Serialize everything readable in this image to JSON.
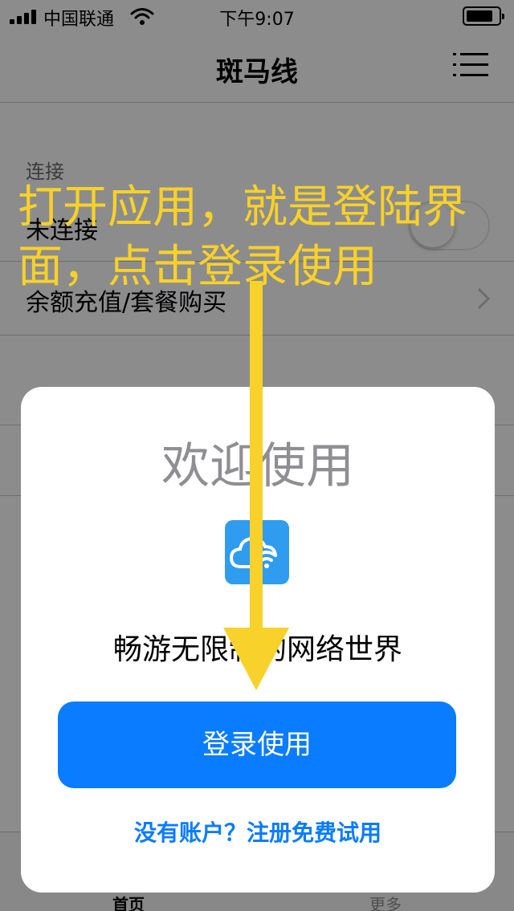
{
  "status_bar": {
    "carrier": "中国联通",
    "time": "下午9:07",
    "icons": [
      "signal-icon",
      "wifi-icon",
      "battery-icon"
    ]
  },
  "nav": {
    "title": "斑马线",
    "menu_icon": "menu-icon"
  },
  "background_list": {
    "section_header": "连接",
    "rows": [
      {
        "label": "未连接",
        "control": "switch",
        "switch_on": false
      },
      {
        "label": "余额充值/套餐购买",
        "control": "chevron"
      }
    ]
  },
  "tab_bar": {
    "tabs": [
      {
        "label": "首页",
        "active": true
      },
      {
        "label": "更多",
        "active": false
      }
    ]
  },
  "modal": {
    "title": "欢迎使用",
    "icon": "cloud-wifi-app-icon",
    "slogan": "畅游无限制的网络世界",
    "login_button": "登录使用",
    "register_link": "没有账户？注册免费试用"
  },
  "annotation": {
    "text": "打开应用，就是登陆界面，点击登录使用",
    "color": "#f8d12a"
  },
  "colors": {
    "primary": "#0a7cff",
    "app_icon": "#2f9cf0",
    "annotation": "#f8d12a"
  }
}
